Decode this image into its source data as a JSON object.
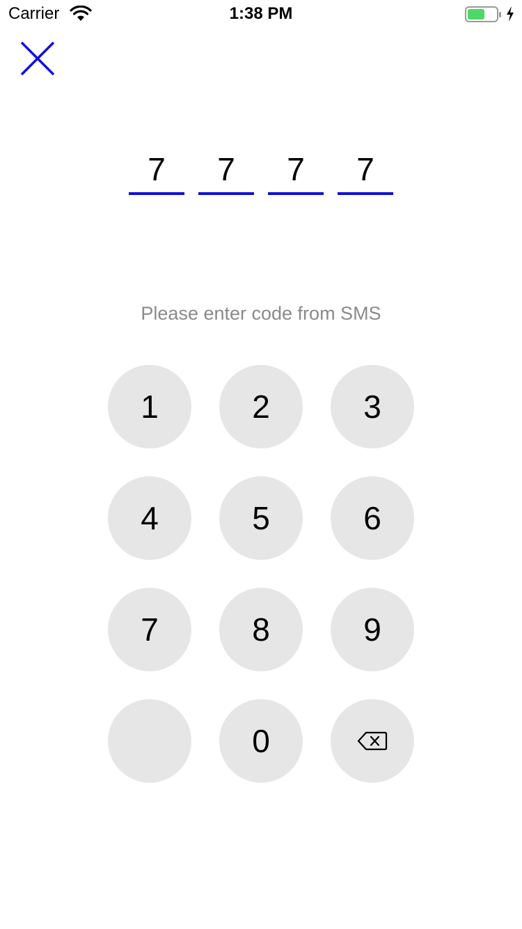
{
  "status_bar": {
    "carrier": "Carrier",
    "time": "1:38 PM",
    "battery_level": 0.6,
    "battery_color": "#4cd964"
  },
  "accent_color": "#1010d8",
  "close_icon": "close-icon",
  "code": {
    "digits": [
      "7",
      "7",
      "7",
      "7"
    ]
  },
  "instruction": "Please enter code from SMS",
  "keypad": {
    "keys": [
      "1",
      "2",
      "3",
      "4",
      "5",
      "6",
      "7",
      "8",
      "9",
      "",
      "0",
      "backspace-icon"
    ]
  }
}
